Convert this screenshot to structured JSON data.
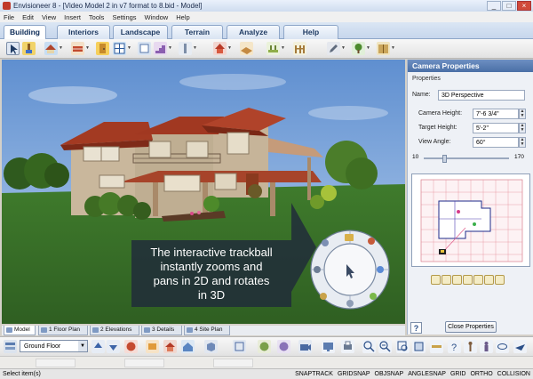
{
  "window": {
    "title": "Envisioneer 8 - [Video Model 2 in v7 format to 8.bid - Model]",
    "buttons": [
      "_",
      "□",
      "×"
    ]
  },
  "menu": [
    "File",
    "Edit",
    "View",
    "Insert",
    "Tools",
    "Settings",
    "Window",
    "Help"
  ],
  "tabs": [
    "Building",
    "Interiors",
    "Landscape",
    "Terrain",
    "Analyze",
    "Help"
  ],
  "active_tab": "Building",
  "overlay": {
    "lines": [
      "The interactive trackball",
      "instantly zooms and",
      "pans in 2D and rotates",
      "in 3D"
    ]
  },
  "camera_panel": {
    "title": "Camera Properties",
    "section": "Properties",
    "name_label": "Name:",
    "name_value": "3D Perspective",
    "camera_height_label": "Camera Height:",
    "camera_height_value": "7'-6 3/4\"",
    "target_height_label": "Target Height:",
    "target_height_value": "5'-2\"",
    "view_angle_label": "View Angle:",
    "view_angle_value": "60°",
    "slider_min": "10",
    "slider_max": "170",
    "slider_fraction": 0.25,
    "help_label": "?",
    "close_label": "Close Properties"
  },
  "view_tabs": [
    "Model",
    "1 Floor Plan",
    "2 Elevations",
    "3 Details",
    "4 Site Plan"
  ],
  "active_view_tab": "Model",
  "floor_combo": "Ground Floor",
  "status": {
    "left": "Select item(s)",
    "flags": [
      "SNAPTRACK",
      "GRIDSNAP",
      "OBJSNAP",
      "ANGLESNAP",
      "GRID",
      "ORTHO",
      "COLLISION"
    ]
  },
  "colors": {
    "tab_blue": "#1f3b63",
    "panel_header": "#4a6fa6",
    "sky": "#6f9ed6",
    "grass": "#3e7a2d",
    "roof": "#a33a22"
  }
}
